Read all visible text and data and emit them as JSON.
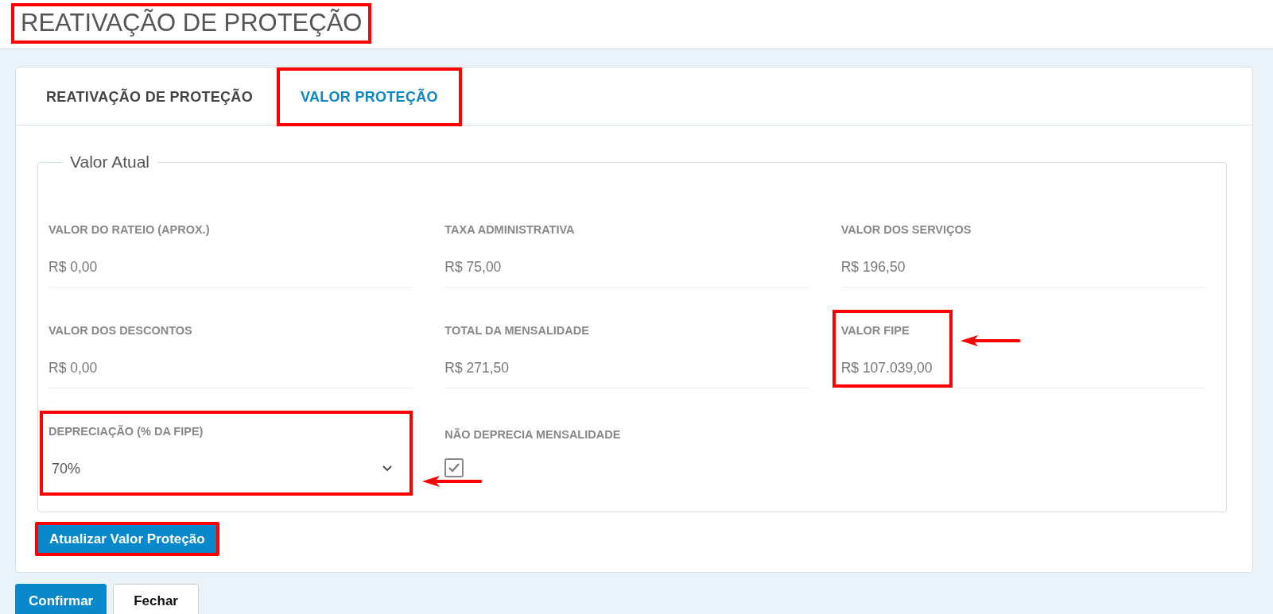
{
  "page_title": {
    "text": "REATIVAÇÃO DE PROTEÇÃO",
    "highlighted": true
  },
  "tabs": [
    {
      "label": "REATIVAÇÃO DE PROTEÇÃO",
      "selected": false,
      "highlighted": false
    },
    {
      "label": "VALOR PROTEÇÃO",
      "selected": true,
      "highlighted": true
    }
  ],
  "fieldset": {
    "legend": "Valor Atual",
    "fields": [
      {
        "kind": "value",
        "label": "VALOR DO RATEIO (APROX.)",
        "value": "R$ 0,00",
        "highlighted": false,
        "arrow": false
      },
      {
        "kind": "value",
        "label": "TAXA ADMINISTRATIVA",
        "value": "R$ 75,00",
        "highlighted": false,
        "arrow": false
      },
      {
        "kind": "value",
        "label": "VALOR DOS SERVIÇOS",
        "value": "R$ 196,50",
        "highlighted": false,
        "arrow": false
      },
      {
        "kind": "value",
        "label": "VALOR DOS DESCONTOS",
        "value": "R$ 0,00",
        "highlighted": false,
        "arrow": false
      },
      {
        "kind": "value",
        "label": "TOTAL DA MENSALIDADE",
        "value": "R$ 271,50",
        "highlighted": false,
        "arrow": false
      },
      {
        "kind": "value",
        "label": "VALOR FIPE",
        "value": "R$ 107.039,00",
        "highlighted": true,
        "arrow": true
      },
      {
        "kind": "select",
        "label": "DEPRECIAÇÃO (% DA FIPE)",
        "value": "70%",
        "highlighted": true,
        "arrow": true
      },
      {
        "kind": "checkbox",
        "label": "NÃO DEPRECIA MENSALIDADE",
        "checked": true,
        "highlighted": false,
        "arrow": false
      }
    ]
  },
  "update_button": {
    "label": "Atualizar Valor Proteção",
    "highlighted": true
  },
  "footer_buttons": [
    {
      "label": "Confirmar",
      "kind": "primary"
    },
    {
      "label": "Fechar",
      "kind": "secondary"
    }
  ]
}
